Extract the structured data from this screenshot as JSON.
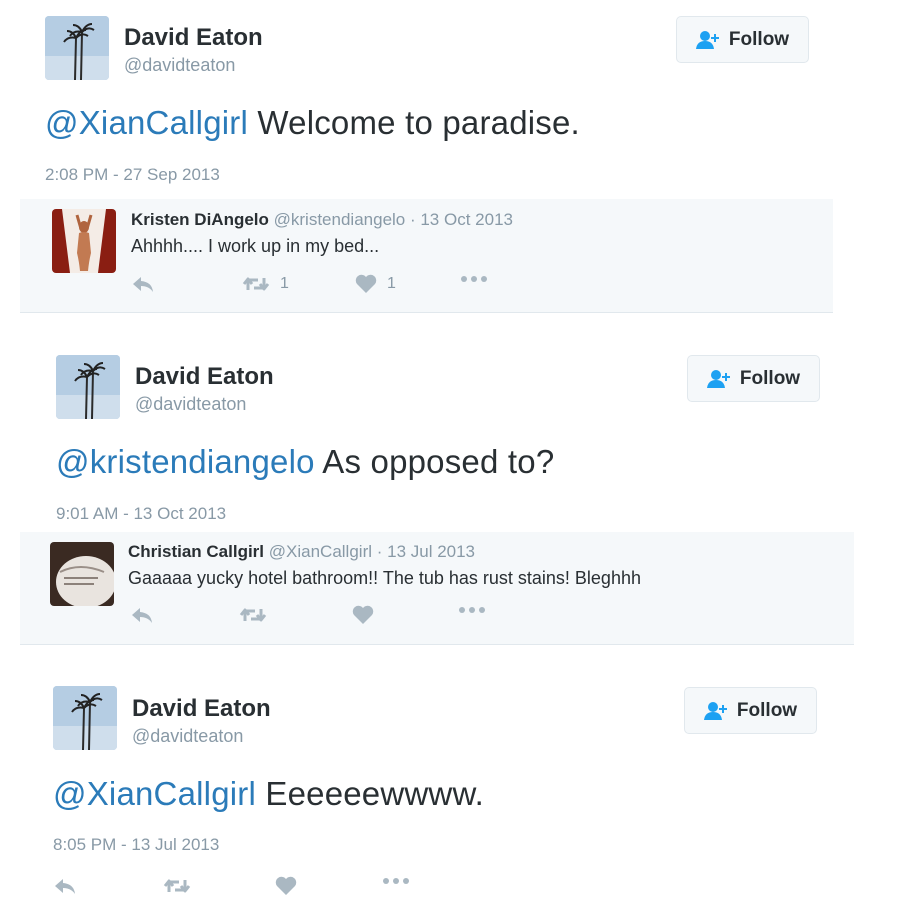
{
  "tweets": [
    {
      "author_name": "David Eaton",
      "author_handle": "@davidteaton",
      "follow_label": "Follow",
      "mention": "@XianCallgirl",
      "text": " Welcome to paradise.",
      "timestamp": "2:08 PM - 27 Sep 2013",
      "quote": {
        "name": "Kristen DiAngelo",
        "meta": "@kristendiangelo · 13 Oct 2013",
        "text": "Ahhhh.... I work up in my bed...",
        "retweet_count": "1",
        "like_count": "1"
      }
    },
    {
      "author_name": "David Eaton",
      "author_handle": "@davidteaton",
      "follow_label": "Follow",
      "mention": "@kristendiangelo",
      "text": " As opposed to?",
      "timestamp": "9:01 AM - 13 Oct 2013",
      "quote": {
        "name": "Christian Callgirl",
        "meta": "@XianCallgirl · 13 Jul 2013",
        "text": "Gaaaaa yucky hotel bathroom!! The tub has rust stains! Bleghhh"
      }
    },
    {
      "author_name": "David Eaton",
      "author_handle": "@davidteaton",
      "follow_label": "Follow",
      "mention": "@XianCallgirl",
      "text": " Eeeeeewwww.",
      "timestamp": "8:05 PM - 13 Jul 2013"
    }
  ],
  "icons": {
    "follow": "add-user-icon",
    "reply": "reply-icon",
    "retweet": "retweet-icon",
    "like": "heart-icon",
    "more": "more-dots-icon"
  },
  "colors": {
    "mention": "#2b7bb9",
    "secondary_text": "#8899a6",
    "icon": "#aab8c2",
    "follow_icon": "#1da1f2",
    "quote_background": "#f5f8fa"
  }
}
